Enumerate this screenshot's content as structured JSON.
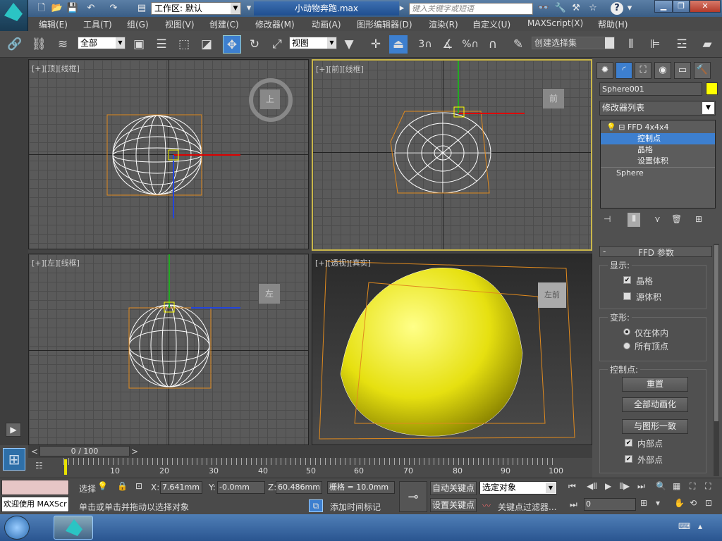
{
  "titlebar": {
    "workspace_label": "工作区: 默认",
    "file_title": "小动物奔跑.max",
    "search_placeholder": "键入关键字或短语"
  },
  "menu": [
    "编辑(E)",
    "工具(T)",
    "组(G)",
    "视图(V)",
    "创建(C)",
    "修改器(M)",
    "动画(A)",
    "图形编辑器(D)",
    "渲染(R)",
    "自定义(U)",
    "MAXScript(X)",
    "帮助(H)"
  ],
  "toolbar": {
    "filter": "全部",
    "ref_coord": "视图",
    "snap_3": "3",
    "snap_pct": "%",
    "named_sel": "创建选择集"
  },
  "viewports": {
    "top": "[+][顶][线框]",
    "front": "[+][前][线框]",
    "left": "[+][左][线框]",
    "persp": "[+][透视][真实]",
    "cube_top": "上",
    "cube_front": "前",
    "cube_left": "左",
    "cube_persp": "左前"
  },
  "command_panel": {
    "object_name": "Sphere001",
    "object_color": "#ffff00",
    "modifier_list": "修改器列表",
    "stack": [
      "FFD 4x4x4",
      "控制点",
      "晶格",
      "设置体积",
      "Sphere"
    ],
    "rollout_title": "FFD 参数",
    "display_label": "显示:",
    "lattice": "晶格",
    "lattice_checked": true,
    "source_volume": "源体积",
    "source_volume_checked": false,
    "deform_label": "变形:",
    "only_in_volume": "仅在体内",
    "all_vertices": "所有顶点",
    "cp_label": "控制点:",
    "reset": "重置",
    "animate_all": "全部动画化",
    "conform": "与图形一致",
    "inside_points": "内部点",
    "inside_checked": true,
    "outside_points": "外部点",
    "outside_checked": true
  },
  "timeline": {
    "range": "0 / 100",
    "ticks": [
      "10",
      "20",
      "30",
      "40",
      "50",
      "60",
      "70",
      "80",
      "90",
      "100"
    ]
  },
  "status": {
    "welcome": "欢迎使用 MAXScr",
    "sel_label": "选择",
    "x_label": "X:",
    "x": "7.641mm",
    "y_label": "Y:",
    "y": "-0.0mm",
    "z_label": "Z:",
    "z": "60.486mm",
    "grid": "栅格 = 10.0mm",
    "prompt": "单击或单击并拖动以选择对象",
    "add_tag": "添加时间标记",
    "autokey": "自动关键点",
    "setkey": "设置关键点",
    "sel_obj": "选定对象",
    "key_filter": "关键点过滤器...",
    "frame": "0"
  }
}
